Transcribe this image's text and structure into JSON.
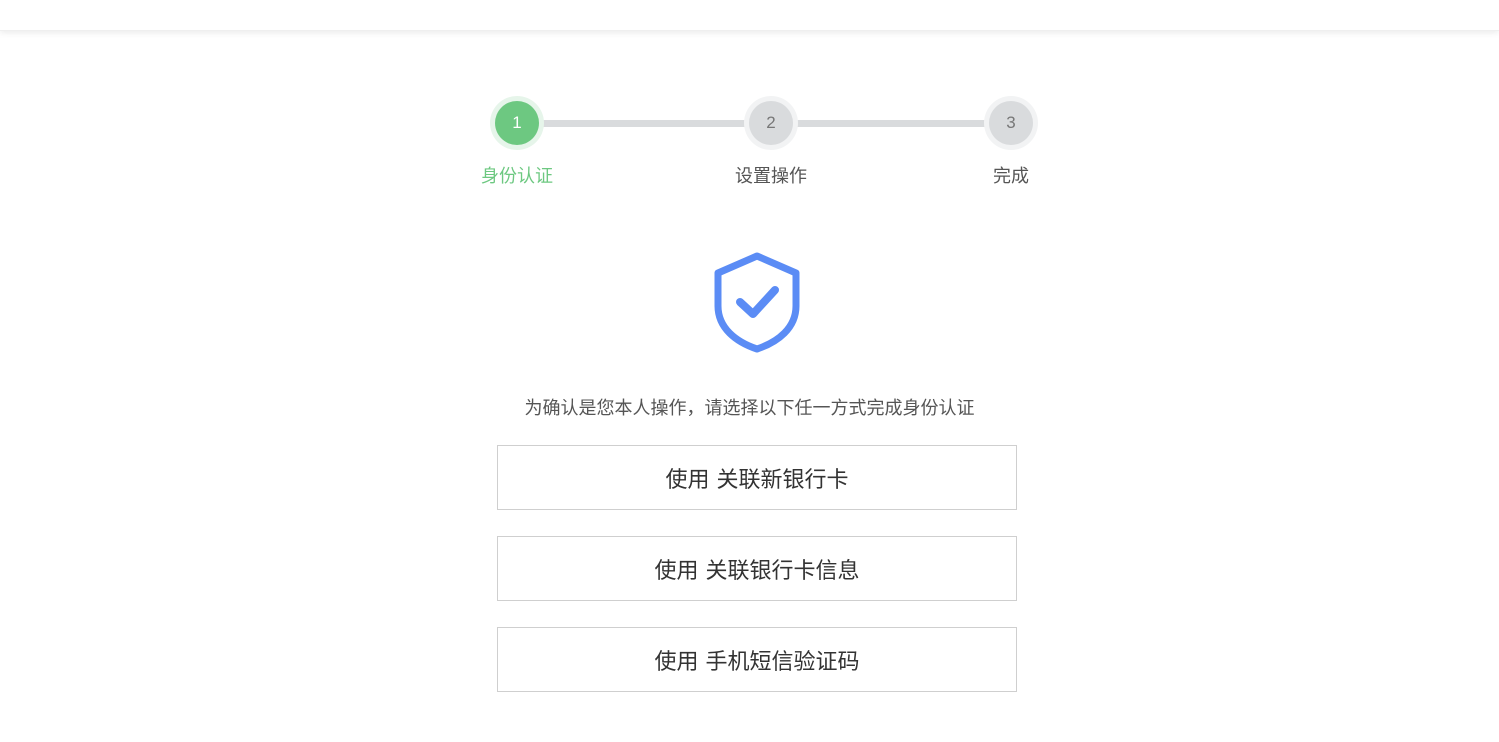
{
  "steps": [
    {
      "number": "1",
      "label": "身份认证",
      "state": "active"
    },
    {
      "number": "2",
      "label": "设置操作",
      "state": "pending"
    },
    {
      "number": "3",
      "label": "完成",
      "state": "pending"
    }
  ],
  "icon": {
    "name": "shield-check-icon",
    "color": "#5b8cf5"
  },
  "prompt": "为确认是您本人操作，请选择以下任一方式完成身份认证",
  "options": [
    {
      "label": "使用 关联新银行卡"
    },
    {
      "label": "使用 关联银行卡信息"
    },
    {
      "label": "使用 手机短信验证码"
    }
  ],
  "colors": {
    "active": "#6dc881",
    "pending": "#d9dbdd",
    "accent": "#5b8cf5"
  }
}
